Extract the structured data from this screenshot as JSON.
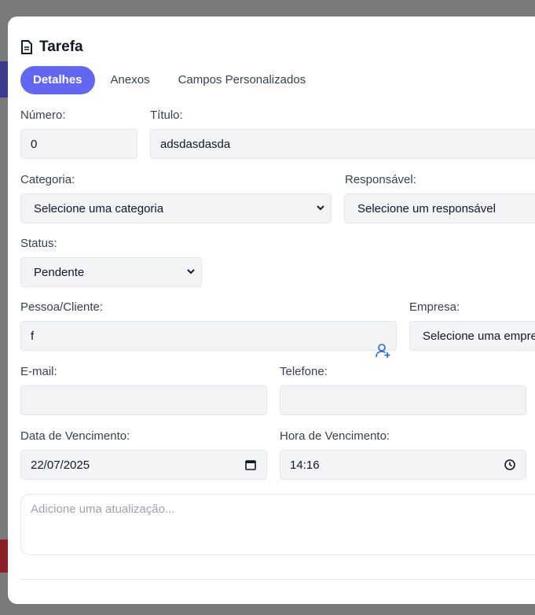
{
  "modal": {
    "title": "Tarefa",
    "tabs": [
      "Detalhes",
      "Anexos",
      "Campos Personalizados"
    ]
  },
  "form": {
    "numero": {
      "label": "Número:",
      "value": "0"
    },
    "titulo": {
      "label": "Título:",
      "value": "adsdasdasda"
    },
    "categoria": {
      "label": "Categoria:",
      "value": "Selecione uma categoria"
    },
    "responsavel": {
      "label": "Responsável:",
      "value": "Selecione um responsável"
    },
    "status": {
      "label": "Status:",
      "value": "Pendente"
    },
    "pessoa": {
      "label": "Pessoa/Cliente:",
      "value": "f"
    },
    "empresa": {
      "label": "Empresa:",
      "value": "Selecione uma empre"
    },
    "email": {
      "label": "E-mail:",
      "value": ""
    },
    "telefone": {
      "label": "Telefone:",
      "value": ""
    },
    "data_vencimento": {
      "label": "Data de Vencimento:",
      "value": "22/07/2025"
    },
    "hora_vencimento": {
      "label": "Hora de Vencimento:",
      "value": "14:16"
    },
    "atualizacao": {
      "placeholder": "Adicione uma atualização..."
    }
  },
  "colors": {
    "accent": "#6366f1",
    "icon_blue": "#2563eb"
  }
}
